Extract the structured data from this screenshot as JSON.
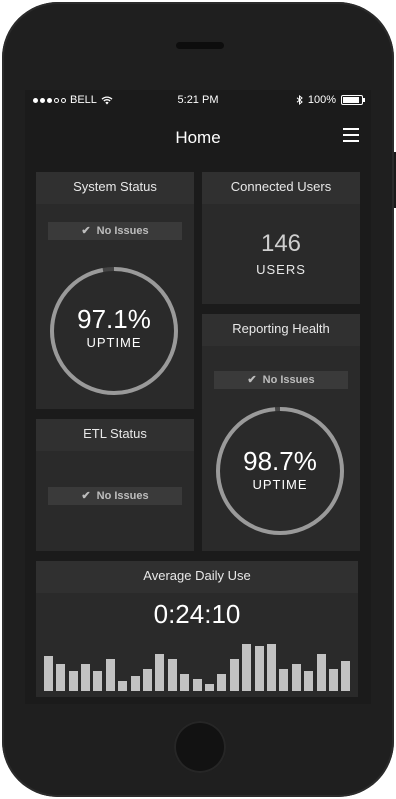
{
  "status_bar": {
    "carrier": "BELL",
    "time": "5:21 PM",
    "battery": "100%"
  },
  "nav": {
    "title": "Home",
    "menu_icon": "hamburger-menu-icon"
  },
  "system_status": {
    "title": "System Status",
    "badge": "No Issues",
    "value": "97.1%",
    "label": "UPTIME",
    "fraction": 0.971
  },
  "connected_users": {
    "title": "Connected Users",
    "value": "146",
    "label": "USERS"
  },
  "reporting_health": {
    "title": "Reporting Health",
    "badge": "No Issues",
    "value": "98.7%",
    "label": "UPTIME",
    "fraction": 0.987
  },
  "etl_status": {
    "title": "ETL Status",
    "badge": "No Issues"
  },
  "average_daily_use": {
    "title": "Average Daily Use",
    "value": "0:24:10",
    "bars": [
      0.7,
      0.55,
      0.4,
      0.55,
      0.4,
      0.65,
      0.2,
      0.3,
      0.45,
      0.75,
      0.65,
      0.35,
      0.25,
      0.15,
      0.35,
      0.65,
      0.95,
      0.9,
      0.95,
      0.45,
      0.55,
      0.4,
      0.75,
      0.45,
      0.6
    ]
  },
  "colors": {
    "background": "#1b1b1b",
    "card": "#2a2a2a",
    "ring": "#9a9a9a",
    "bar": "#c2c2c2"
  }
}
